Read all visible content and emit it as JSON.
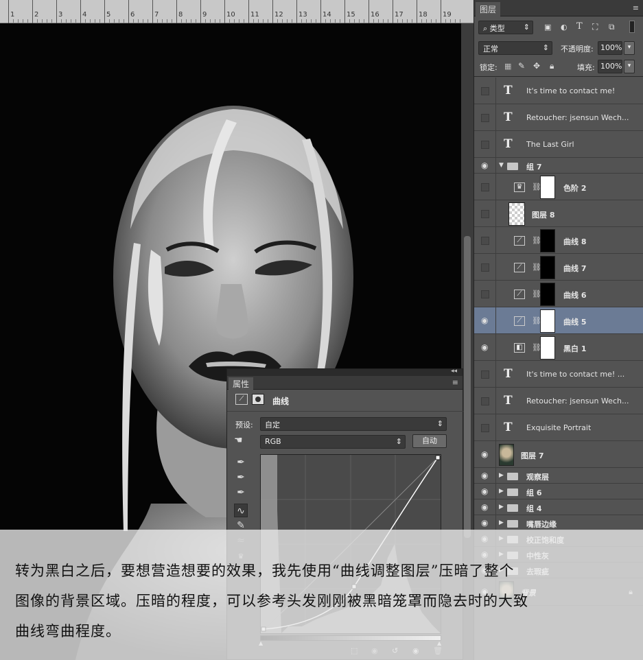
{
  "ruler": {
    "labels": [
      "1",
      "2",
      "3",
      "4",
      "5",
      "6",
      "7",
      "8",
      "9",
      "10",
      "11",
      "12",
      "13",
      "14",
      "15",
      "16",
      "17",
      "18",
      "19"
    ]
  },
  "layers_panel": {
    "tab": "图层",
    "filter_kind": "类型",
    "blend_mode": "正常",
    "opacity_label": "不透明度:",
    "opacity_value": "100%",
    "lock_label": "锁定:",
    "fill_label": "填充:",
    "fill_value": "100%",
    "layers": [
      {
        "name": "It's time to contact me!",
        "kind": "text",
        "visible": false
      },
      {
        "name": "Retoucher: jsensun Wech...",
        "kind": "text",
        "visible": false
      },
      {
        "name": "The Last Girl",
        "kind": "text",
        "visible": false
      },
      {
        "name": "组 7",
        "kind": "group-open",
        "visible": true
      },
      {
        "name": "色阶 2",
        "kind": "levels",
        "visible": false
      },
      {
        "name": "图层 8",
        "kind": "pixel",
        "visible": false
      },
      {
        "name": "曲线 8",
        "kind": "curves",
        "visible": false
      },
      {
        "name": "曲线 7",
        "kind": "curves",
        "visible": false
      },
      {
        "name": "曲线 6",
        "kind": "curves",
        "visible": false
      },
      {
        "name": "曲线 5",
        "kind": "curves",
        "visible": true,
        "selected": true
      },
      {
        "name": "黑白 1",
        "kind": "bw",
        "visible": true
      },
      {
        "name": "It's time to contact me! ...",
        "kind": "text",
        "visible": false
      },
      {
        "name": "Retoucher: jsensun Wech...",
        "kind": "text",
        "visible": false
      },
      {
        "name": "Exquisite Portrait",
        "kind": "text",
        "visible": false
      },
      {
        "name": "图层 7",
        "kind": "photo",
        "visible": true
      },
      {
        "name": "观察层",
        "kind": "group",
        "visible": true
      },
      {
        "name": "组 6",
        "kind": "group",
        "visible": true
      },
      {
        "name": "组 4",
        "kind": "group",
        "visible": true
      },
      {
        "name": "嘴唇边缘",
        "kind": "group",
        "visible": true
      },
      {
        "name": "校正饱和度",
        "kind": "group",
        "visible": true
      },
      {
        "name": "中性灰",
        "kind": "group",
        "visible": true
      },
      {
        "name": "去瑕疵",
        "kind": "group",
        "visible": true
      },
      {
        "name": "背景",
        "kind": "background",
        "visible": true
      }
    ]
  },
  "properties_panel": {
    "tab": "属性",
    "title": "曲线",
    "preset_label": "预设:",
    "preset_value": "自定",
    "channel": "RGB",
    "auto_button": "自动"
  },
  "overlay_text": [
    "转为黑白之后，要想营造想要的效果，我先使用“曲线调整图层”压暗了整个",
    "图像的背景区域。压暗的程度，可以参考头发刚刚被黑暗笼罩而隐去时的大致",
    "曲线弯曲程度。"
  ]
}
